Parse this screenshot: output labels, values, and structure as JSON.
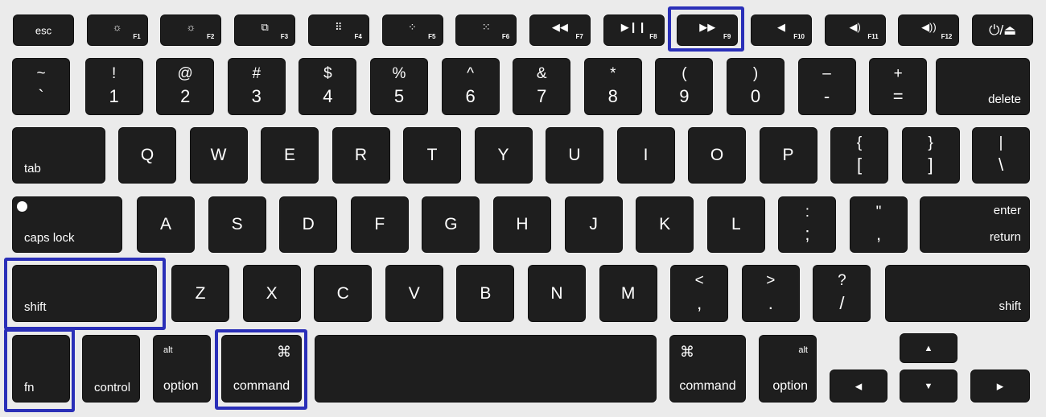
{
  "highlight_color": "#2a2fb8",
  "highlighted_keys": [
    "F9",
    "shift",
    "fn",
    "command"
  ],
  "function_row": [
    {
      "label": "esc"
    },
    {
      "icon": "☼",
      "f": "F1",
      "icon_name": "brightness-down-icon"
    },
    {
      "icon": "☼",
      "f": "F2",
      "icon_name": "brightness-up-icon"
    },
    {
      "icon": "⧉",
      "f": "F3",
      "icon_name": "mission-control-icon"
    },
    {
      "icon": "⠿",
      "f": "F4",
      "icon_name": "launchpad-icon"
    },
    {
      "icon": "⁘",
      "f": "F5",
      "icon_name": "keyboard-light-down-icon"
    },
    {
      "icon": "⁙",
      "f": "F6",
      "icon_name": "keyboard-light-up-icon"
    },
    {
      "icon": "◀◀",
      "f": "F7",
      "icon_name": "rewind-icon"
    },
    {
      "icon": "▶❙❙",
      "f": "F8",
      "icon_name": "play-pause-icon"
    },
    {
      "icon": "▶▶",
      "f": "F9",
      "icon_name": "fast-forward-icon"
    },
    {
      "icon": "◀",
      "f": "F10",
      "icon_name": "mute-icon"
    },
    {
      "icon": "◀)",
      "f": "F11",
      "icon_name": "volume-down-icon"
    },
    {
      "icon": "◀))",
      "f": "F12",
      "icon_name": "volume-up-icon"
    },
    {
      "icon": "⏻/⏏",
      "f": "",
      "icon_name": "power-eject-icon"
    }
  ],
  "number_row": [
    {
      "top": "~",
      "bot": "`"
    },
    {
      "top": "!",
      "bot": "1"
    },
    {
      "top": "@",
      "bot": "2"
    },
    {
      "top": "#",
      "bot": "3"
    },
    {
      "top": "$",
      "bot": "4"
    },
    {
      "top": "%",
      "bot": "5"
    },
    {
      "top": "^",
      "bot": "6"
    },
    {
      "top": "&",
      "bot": "7"
    },
    {
      "top": "*",
      "bot": "8"
    },
    {
      "top": "(",
      "bot": "9"
    },
    {
      "top": ")",
      "bot": "0"
    },
    {
      "top": "–",
      "bot": "-"
    },
    {
      "top": "+",
      "bot": "="
    },
    {
      "label": "delete"
    }
  ],
  "qwerty_row": [
    {
      "label": "tab"
    },
    {
      "label": "Q"
    },
    {
      "label": "W"
    },
    {
      "label": "E"
    },
    {
      "label": "R"
    },
    {
      "label": "T"
    },
    {
      "label": "Y"
    },
    {
      "label": "U"
    },
    {
      "label": "I"
    },
    {
      "label": "O"
    },
    {
      "label": "P"
    },
    {
      "top": "{",
      "bot": "["
    },
    {
      "top": "}",
      "bot": "]"
    },
    {
      "top": "|",
      "bot": "\\"
    }
  ],
  "home_row": [
    {
      "label": "caps lock"
    },
    {
      "label": "A"
    },
    {
      "label": "S"
    },
    {
      "label": "D"
    },
    {
      "label": "F"
    },
    {
      "label": "G"
    },
    {
      "label": "H"
    },
    {
      "label": "J"
    },
    {
      "label": "K"
    },
    {
      "label": "L"
    },
    {
      "top": ":",
      "bot": ";"
    },
    {
      "top": "\"",
      "bot": ","
    },
    {
      "top": "enter",
      "label": "return"
    }
  ],
  "shift_row": [
    {
      "label": "shift"
    },
    {
      "label": "Z"
    },
    {
      "label": "X"
    },
    {
      "label": "C"
    },
    {
      "label": "V"
    },
    {
      "label": "B"
    },
    {
      "label": "N"
    },
    {
      "label": "M"
    },
    {
      "top": "<",
      "bot": ","
    },
    {
      "top": ">",
      "bot": "."
    },
    {
      "top": "?",
      "bot": "/"
    },
    {
      "label": "shift"
    }
  ],
  "bottom_row": [
    {
      "label": "fn"
    },
    {
      "label": "control"
    },
    {
      "small": "alt",
      "label": "option"
    },
    {
      "sym": "⌘",
      "label": "command"
    },
    {
      "label": ""
    },
    {
      "sym": "⌘",
      "label": "command"
    },
    {
      "small": "alt",
      "label": "option"
    },
    {
      "label": "▲"
    },
    {
      "label": "◀"
    },
    {
      "label": "▼"
    },
    {
      "label": "▶"
    }
  ]
}
